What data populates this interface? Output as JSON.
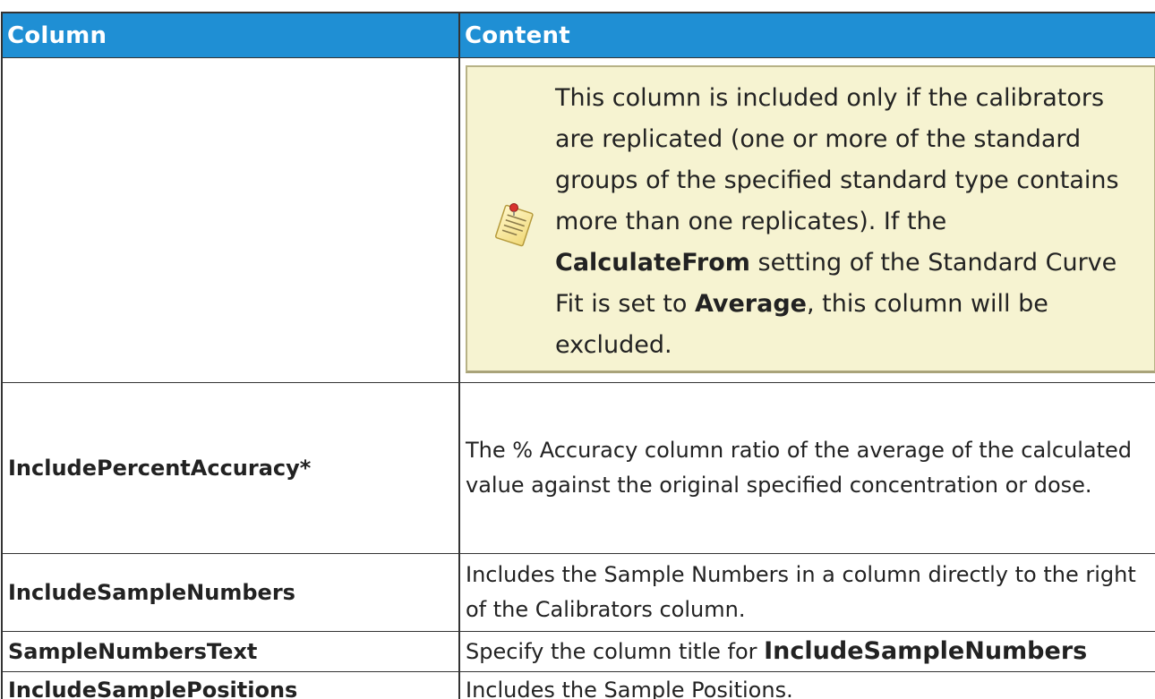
{
  "table": {
    "headers": [
      "Column",
      "Content"
    ],
    "note": {
      "icon": "note-pad-icon",
      "line1": "This column is included only if the calibrators are replicated (one or more of the standard groups of the specified standard type contains more than one replicates). If the ",
      "bold1": "CalculateFrom",
      "line2": " setting of the Standard Curve Fit is set to ",
      "bold2": "Average",
      "line3": ", this column will be excluded."
    },
    "rows": [
      {
        "name": "IncludePercentAccuracy*",
        "content": "The % Accuracy column ratio of the average of the cal­culated value against the original specified con­centration or dose."
      },
      {
        "name": "IncludeSampleNumbers",
        "content": "Includes the Sample Numbers in a column directly to the right of the Calibrators column."
      },
      {
        "name": "SampleNumbersText",
        "content_prefix": "Specify the column title for ",
        "content_bold": "IncludeSampleNumbers"
      },
      {
        "name": "IncludeSamplePositions",
        "content": "Includes the Sample Positions."
      }
    ]
  },
  "colors": {
    "header_bg": "#1f8fd4",
    "note_bg": "#f6f3d1",
    "note_border": "#b7b286"
  }
}
